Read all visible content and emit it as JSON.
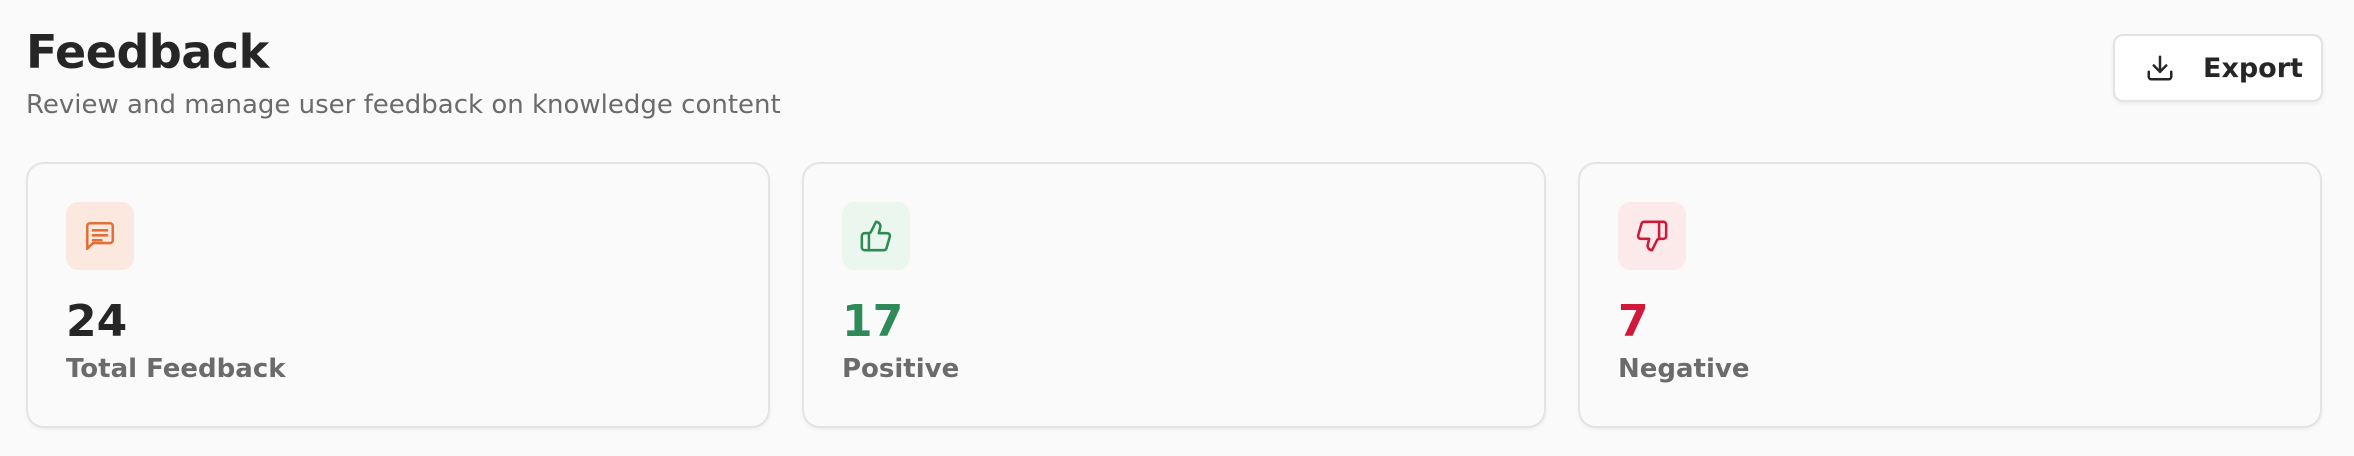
{
  "header": {
    "title": "Feedback",
    "subtitle": "Review and manage user feedback on knowledge content"
  },
  "toolbar": {
    "export_label": "Export",
    "export_icon": "download-icon"
  },
  "stats": [
    {
      "value": "24",
      "label": "Total Feedback",
      "icon": "message-square-text-icon",
      "accent": "#e0703a",
      "icon_bg": "#fbe9e0",
      "value_color": "#262626"
    },
    {
      "value": "17",
      "label": "Positive",
      "icon": "thumbs-up-icon",
      "accent": "#2e8b57",
      "icon_bg": "#eaf6ee",
      "value_color": "#2e8b57"
    },
    {
      "value": "7",
      "label": "Negative",
      "icon": "thumbs-down-icon",
      "accent": "#d0193a",
      "icon_bg": "#fceaea",
      "value_color": "#d0193a"
    }
  ]
}
